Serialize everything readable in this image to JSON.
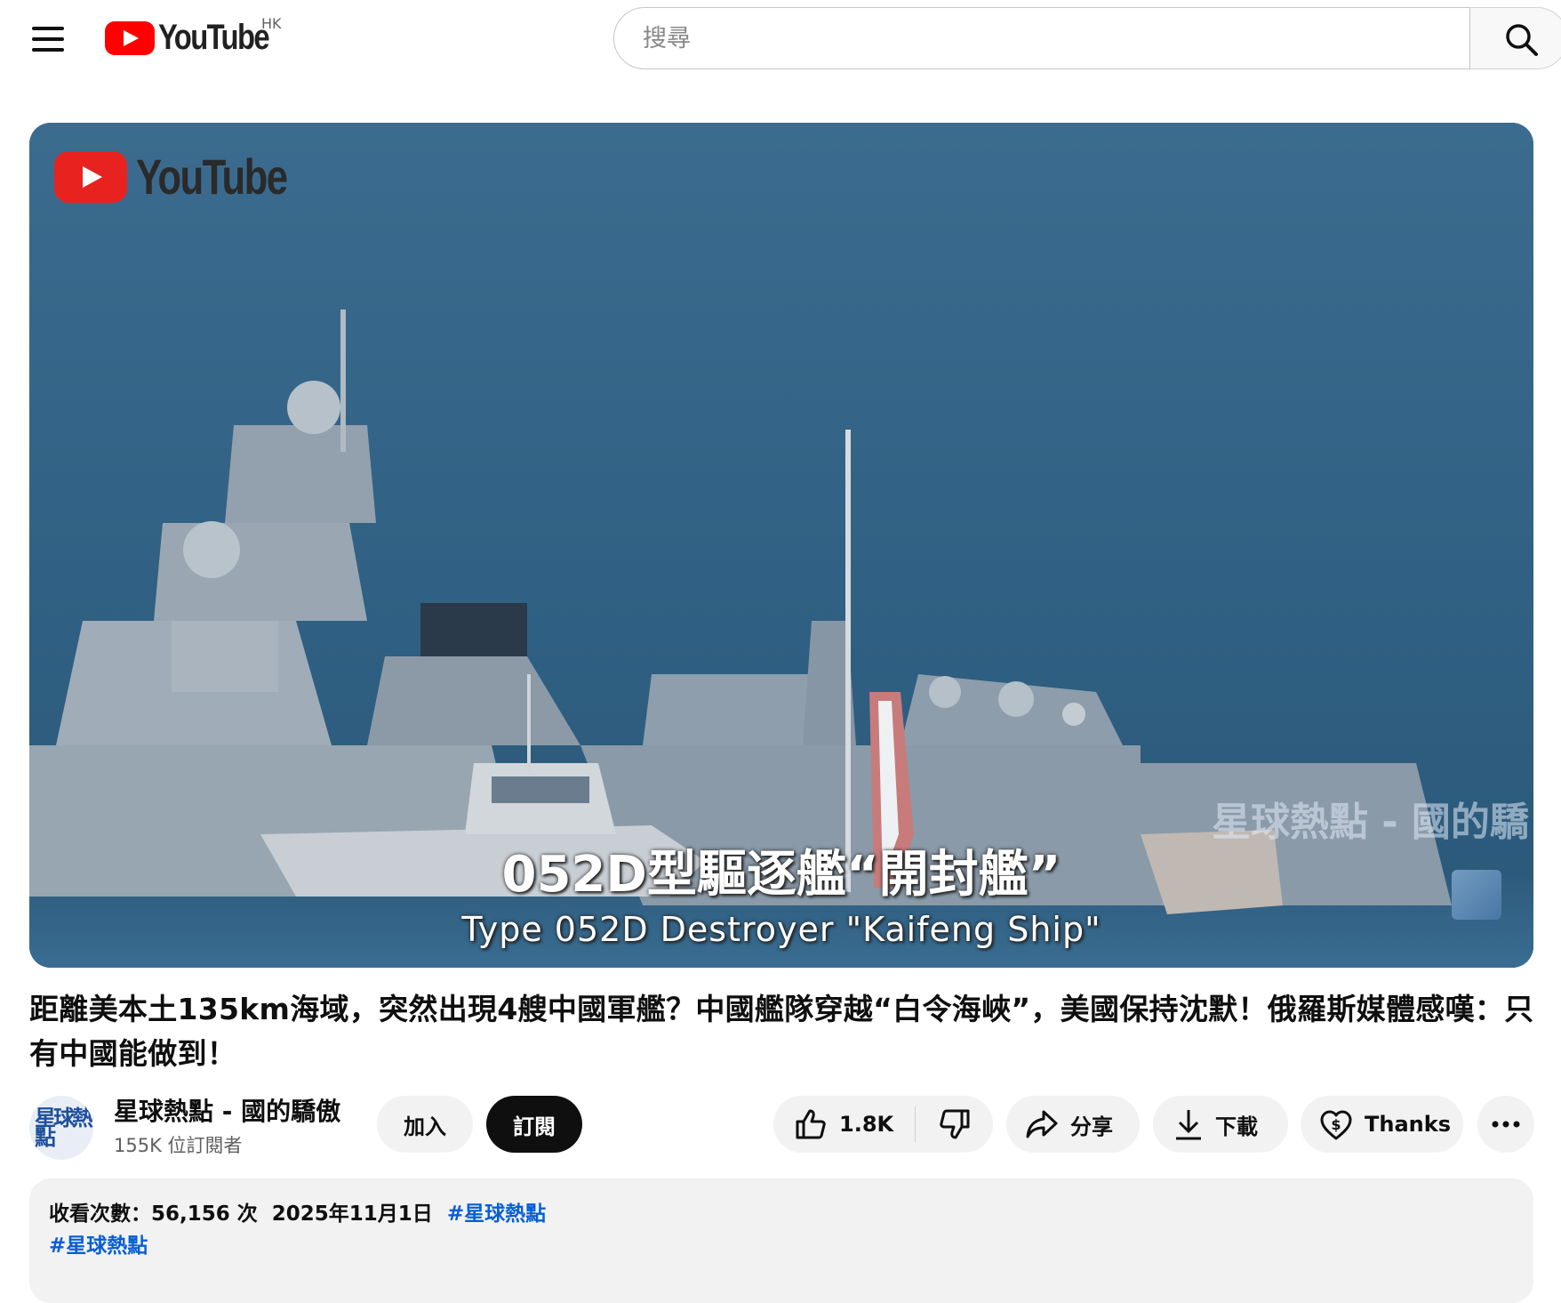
{
  "header": {
    "logo_text": "YouTube",
    "country_code": "HK",
    "search_placeholder": "搜尋"
  },
  "video": {
    "watermark_logo_text": "YouTube",
    "subtitle_zh": "052D型驅逐艦“開封艦”",
    "subtitle_en": "Type 052D Destroyer \"Kaifeng Ship\"",
    "channel_watermark": "星球熱點 - 國的驕"
  },
  "title": "距離美本土135km海域，突然出現4艘中國軍艦？中國艦隊穿越“白令海峽”，美國保持沈默！俄羅斯媒體感嘆：只有中國能做到！",
  "channel": {
    "name": "星球熱點 - 國的驕傲",
    "subscribers": "155K 位訂閱者",
    "avatar_text": "星球熱點",
    "join_label": "加入",
    "subscribe_label": "訂閱"
  },
  "actions": {
    "like_count": "1.8K",
    "share_label": "分享",
    "download_label": "下載",
    "thanks_label": "Thanks"
  },
  "description": {
    "views": "收看次數：56,156 次",
    "date": "2025年11月1日",
    "hashtag1": "#星球熱點",
    "hashtag2": "#星球熱點"
  }
}
